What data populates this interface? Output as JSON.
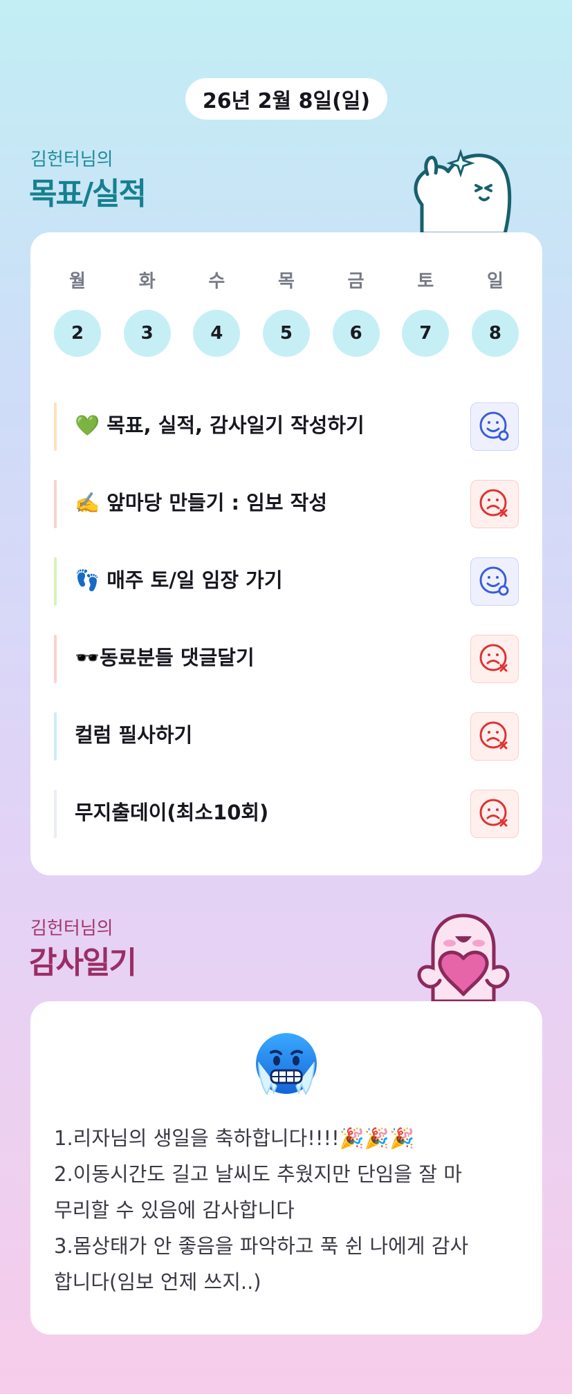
{
  "header": {
    "date": "26년 2월 8일(일)"
  },
  "goals": {
    "subtitle": "김헌터님의",
    "title": "목표/실적",
    "weekdays": [
      "월",
      "화",
      "수",
      "목",
      "금",
      "토",
      "일"
    ],
    "dates": [
      "2",
      "3",
      "4",
      "5",
      "6",
      "7",
      "8"
    ],
    "items": [
      {
        "emoji": "💚",
        "text": "목표, 실적, 감사일기 작성하기",
        "status": "done",
        "status_icon": "happy-face-check-icon",
        "bar_color": "#fde2b8"
      },
      {
        "emoji": "✍️",
        "text": "앞마당 만들기 : 임보 작성",
        "status": "missed",
        "status_icon": "sad-face-x-icon",
        "bar_color": "#f9d2cf"
      },
      {
        "emoji": "👣",
        "text": "매주 토/일 임장 가기",
        "status": "done",
        "status_icon": "happy-face-check-icon",
        "bar_color": "#d8f4b4"
      },
      {
        "emoji": "🕶️",
        "text": "동료분들 댓글달기",
        "status": "missed",
        "status_icon": "sad-face-x-icon",
        "bar_color": "#f9d2cf"
      },
      {
        "emoji": "",
        "text": "컬럼 필사하기",
        "status": "missed",
        "status_icon": "sad-face-x-icon",
        "bar_color": "#c9eefa"
      },
      {
        "emoji": "",
        "text": "무지출데이(최소10회)",
        "status": "missed",
        "status_icon": "sad-face-x-icon",
        "bar_color": "#ebedf3"
      }
    ]
  },
  "gratitude": {
    "subtitle": "김헌터님의",
    "title": "감사일기",
    "mood_icon": "freezing-face-icon",
    "lines": [
      "1.리자님의 생일을 축하합니다!!!!🎉🎉🎉",
      "2.이동시간도 길고 날씨도 추웠지만 단임을 잘 마",
      "무리할 수 있음에 감사합니다",
      "3.몸상태가 안 좋음을 파악하고 푹 쉰 나에게 감사",
      "합니다(임보 언제 쓰지..)"
    ]
  },
  "colors": {
    "accent_teal": "#16808e",
    "accent_magenta": "#9b2d66",
    "done_blue": "#3b5bdb",
    "miss_red": "#e03131"
  }
}
